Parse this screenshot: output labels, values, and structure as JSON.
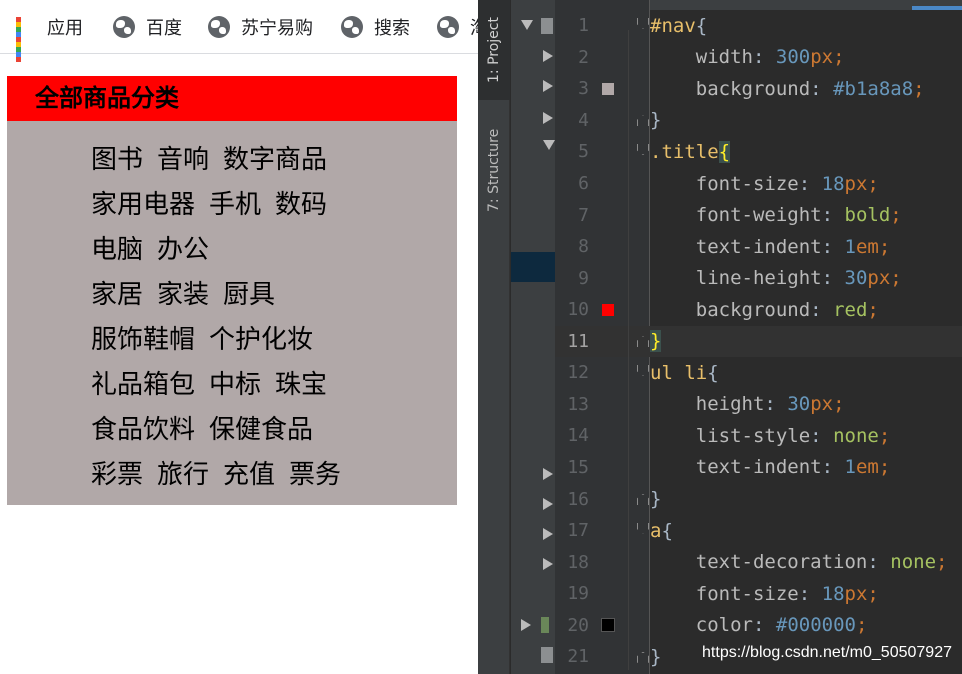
{
  "bookmarks": [
    {
      "label": "应用",
      "icon": "apps-grid-icon"
    },
    {
      "label": "百度",
      "icon": "globe-icon"
    },
    {
      "label": "苏宁易购",
      "icon": "globe-icon"
    },
    {
      "label": "搜索",
      "icon": "globe-icon"
    },
    {
      "label": "淘",
      "icon": "globe-icon"
    }
  ],
  "nav": {
    "title": "全部商品分类",
    "background": "#b1a8a8",
    "title_background": "#ff0000",
    "categories": [
      [
        "图书",
        "音响",
        "数字商品"
      ],
      [
        "家用电器",
        "手机",
        "数码"
      ],
      [
        "电脑",
        "办公"
      ],
      [
        "家居",
        "家装",
        "厨具"
      ],
      [
        "服饰鞋帽",
        "个护化妆"
      ],
      [
        "礼品箱包",
        "中标",
        "珠宝"
      ],
      [
        "食品饮料",
        "保健食品"
      ],
      [
        "彩票",
        "旅行",
        "充值",
        "票务"
      ]
    ]
  },
  "ide": {
    "tool_tabs": {
      "project": "1: Project",
      "structure": "7: Structure"
    },
    "lines": [
      {
        "n": "1",
        "text": "#nav{"
      },
      {
        "n": "2",
        "text": "    width: 300px;"
      },
      {
        "n": "3",
        "text": "    background: #b1a8a8;",
        "swatch": "#b1a8a8"
      },
      {
        "n": "4",
        "text": "}"
      },
      {
        "n": "5",
        "text": ".title{"
      },
      {
        "n": "6",
        "text": "    font-size: 18px;"
      },
      {
        "n": "7",
        "text": "    font-weight: bold;"
      },
      {
        "n": "8",
        "text": "    text-indent: 1em;"
      },
      {
        "n": "9",
        "text": "    line-height: 30px;"
      },
      {
        "n": "10",
        "text": "    background: red;",
        "swatch": "#ff0000"
      },
      {
        "n": "11",
        "text": "}"
      },
      {
        "n": "12",
        "text": "ul li{"
      },
      {
        "n": "13",
        "text": "    height: 30px;"
      },
      {
        "n": "14",
        "text": "    list-style: none;"
      },
      {
        "n": "15",
        "text": "    text-indent: 1em;"
      },
      {
        "n": "16",
        "text": "}"
      },
      {
        "n": "17",
        "text": "a{"
      },
      {
        "n": "18",
        "text": "    text-decoration: none;"
      },
      {
        "n": "19",
        "text": "    font-size: 18px;"
      },
      {
        "n": "20",
        "text": "    color: #000000;",
        "swatch": "#000000"
      },
      {
        "n": "21",
        "text": "}"
      }
    ],
    "current_line": "11"
  },
  "watermark": "https://blog.csdn.net/m0_50507927"
}
